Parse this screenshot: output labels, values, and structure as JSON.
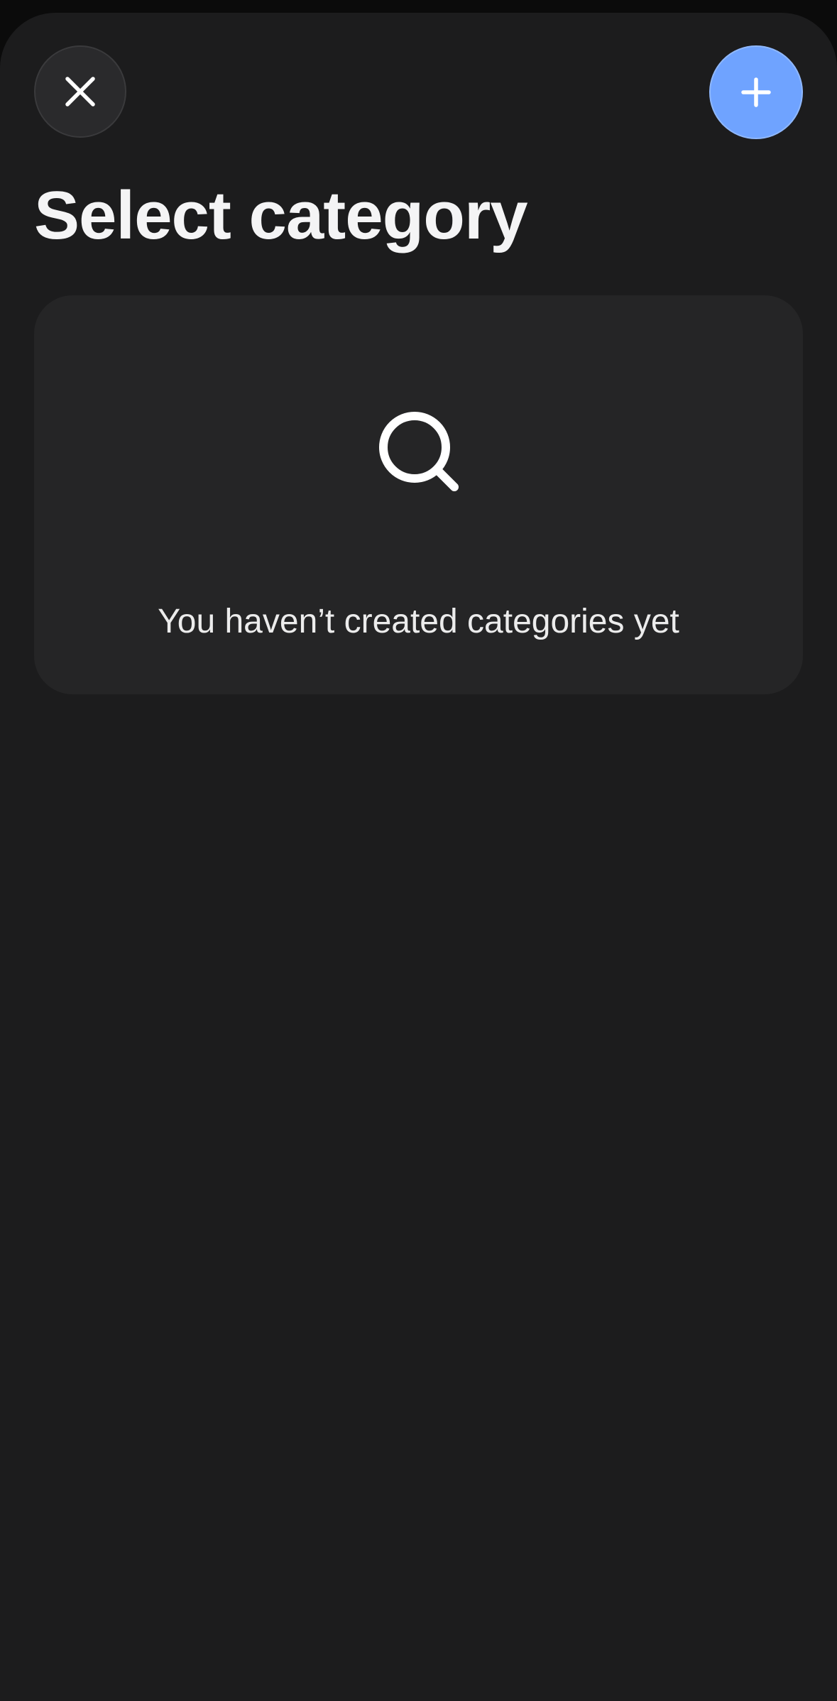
{
  "header": {
    "close_icon": "close-icon",
    "add_icon": "plus-icon",
    "title": "Select category"
  },
  "empty_state": {
    "icon": "search-icon",
    "message": "You haven’t created categories yet"
  },
  "colors": {
    "background": "#1c1c1d",
    "card": "#252526",
    "accent": "#6fa3ff",
    "text": "#f4f4f5"
  }
}
